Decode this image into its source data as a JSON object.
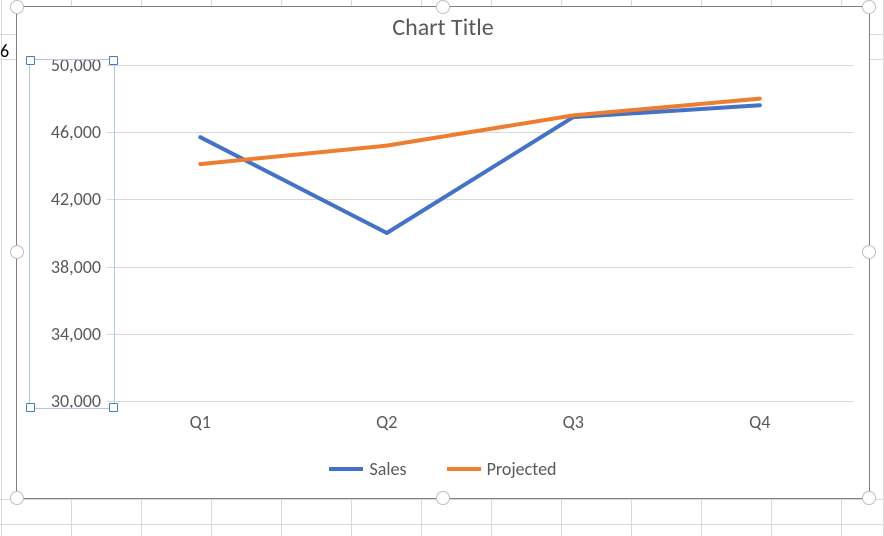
{
  "chart_data": {
    "type": "line",
    "title": "Chart Title",
    "categories": [
      "Q1",
      "Q2",
      "Q3",
      "Q4"
    ],
    "series": [
      {
        "name": "Sales",
        "color": "#4472C4",
        "values": [
          45700,
          40000,
          46900,
          47600
        ]
      },
      {
        "name": "Projected",
        "color": "#ED7D31",
        "values": [
          44100,
          45200,
          47000,
          48000
        ]
      }
    ],
    "xlabel": "",
    "ylabel": "",
    "ylim": [
      30000,
      50000
    ],
    "yticks": [
      30000,
      34000,
      38000,
      42000,
      46000,
      50000
    ],
    "ytick_labels": [
      "30,000",
      "34,000",
      "38,000",
      "42,000",
      "46,000",
      "50,000"
    ],
    "legend_position": "bottom",
    "grid": true
  },
  "ui": {
    "selected_axis": "y",
    "peek_char": "6"
  },
  "colors": {
    "gridline": "#d9d9d9",
    "text": "#595959"
  }
}
